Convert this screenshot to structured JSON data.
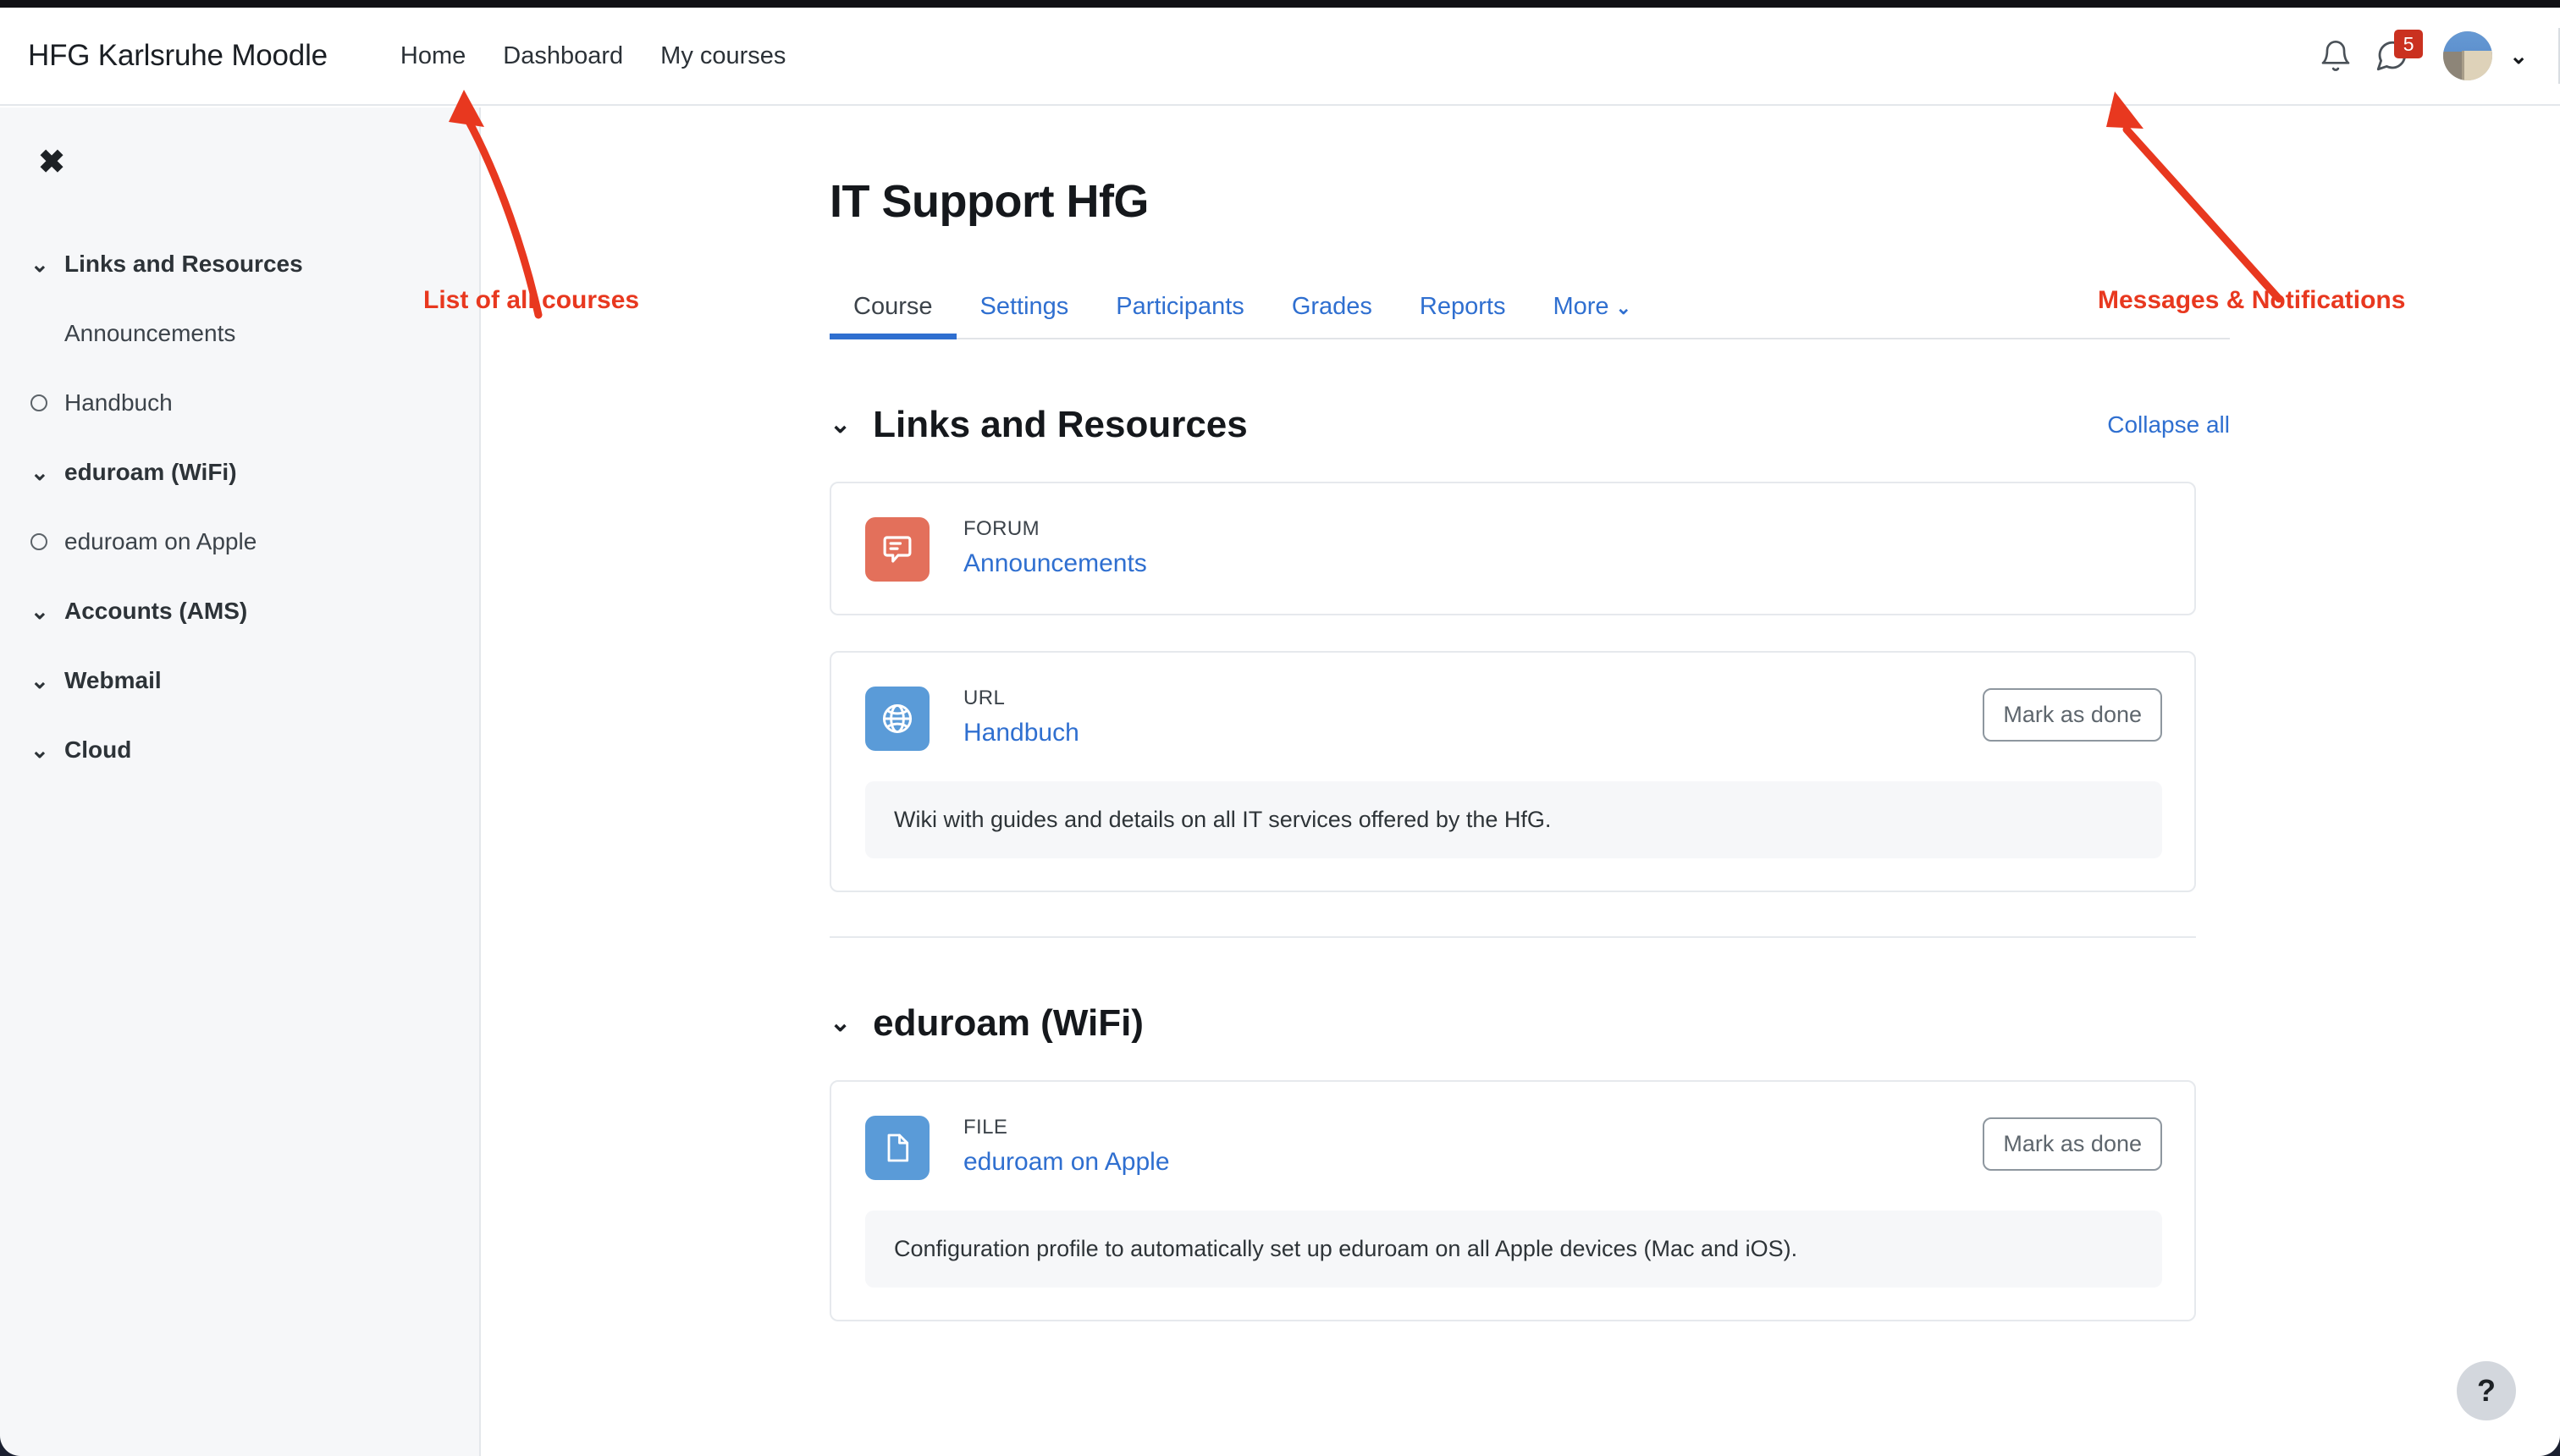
{
  "header": {
    "brand": "HFG Karlsruhe Moodle",
    "nav": [
      {
        "label": "Home"
      },
      {
        "label": "Dashboard"
      },
      {
        "label": "My courses"
      }
    ],
    "notifications_icon": "bell-icon",
    "messages_icon": "message-bubble-icon",
    "messages_badge": "5",
    "user_menu_caret": "⌄"
  },
  "sidebar": {
    "close_label": "✖",
    "items": [
      {
        "label": "Links and Resources",
        "marker": "chevron",
        "bold": true
      },
      {
        "label": "Announcements",
        "marker": "none",
        "bold": false
      },
      {
        "label": "Handbuch",
        "marker": "circle",
        "bold": false
      },
      {
        "label": "eduroam (WiFi)",
        "marker": "chevron",
        "bold": true
      },
      {
        "label": "eduroam on Apple",
        "marker": "circle",
        "bold": false
      },
      {
        "label": "Accounts (AMS)",
        "marker": "chevron",
        "bold": true
      },
      {
        "label": "Webmail",
        "marker": "chevron",
        "bold": true
      },
      {
        "label": "Cloud",
        "marker": "chevron",
        "bold": true
      }
    ]
  },
  "main": {
    "title": "IT Support HfG",
    "tabs": [
      {
        "label": "Course",
        "active": true
      },
      {
        "label": "Settings",
        "active": false
      },
      {
        "label": "Participants",
        "active": false
      },
      {
        "label": "Grades",
        "active": false
      },
      {
        "label": "Reports",
        "active": false
      },
      {
        "label": "More",
        "active": false,
        "caret": "⌄"
      }
    ],
    "collapse_all": "Collapse all",
    "sections": [
      {
        "title": "Links and Resources",
        "chevron": "⌄",
        "activities": [
          {
            "type": "FORUM",
            "name": "Announcements",
            "icon": "forum-icon",
            "icon_color": "#e3705b",
            "mark_as_done": null,
            "description": null
          },
          {
            "type": "URL",
            "name": "Handbuch",
            "icon": "globe-icon",
            "icon_color": "#5a9bd8",
            "mark_as_done": "Mark as done",
            "description": "Wiki with guides and details on all IT services offered by the HfG."
          }
        ]
      },
      {
        "title": "eduroam (WiFi)",
        "chevron": "⌄",
        "activities": [
          {
            "type": "FILE",
            "name": "eduroam on Apple",
            "icon": "file-icon",
            "icon_color": "#5a9bd8",
            "mark_as_done": "Mark as done",
            "description": "Configuration profile to automatically set up eduroam on all Apple devices (Mac and iOS)."
          }
        ]
      }
    ]
  },
  "annotations": {
    "color": "#e8381f",
    "courses": "List of all courses",
    "messages": "Messages & Notifications"
  },
  "help": {
    "label": "?"
  }
}
